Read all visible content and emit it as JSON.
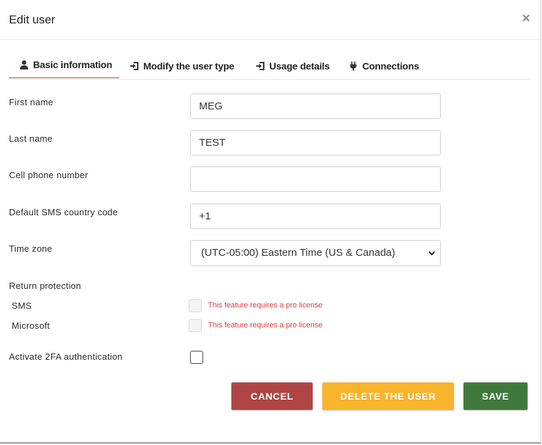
{
  "dialog": {
    "title": "Edit user",
    "close_glyph": "×"
  },
  "tabs": [
    {
      "label": "Basic information",
      "icon": "user-icon",
      "active": true
    },
    {
      "label": "Modify the user type",
      "icon": "sign-in-icon",
      "active": false
    },
    {
      "label": "Usage details",
      "icon": "sign-in-icon",
      "active": false
    },
    {
      "label": "Connections",
      "icon": "plug-icon",
      "active": false
    }
  ],
  "form": {
    "first_name": {
      "label": "First name",
      "value": "MEG"
    },
    "last_name": {
      "label": "Last name",
      "value": "TEST"
    },
    "cell_phone": {
      "label": "Cell phone number",
      "value": ""
    },
    "sms_country_code": {
      "label": "Default SMS country code",
      "value": "+1"
    },
    "time_zone": {
      "label": "Time zone",
      "value": "(UTC-05:00) Eastern Time (US & Canada)"
    },
    "return_protection": {
      "label": "Return protection",
      "sms": {
        "label": "SMS",
        "note": "This feature requires a pro license"
      },
      "microsoft": {
        "label": "Microsoft",
        "note": "This feature requires a pro license"
      }
    },
    "twofa": {
      "label": "Activate 2FA authentication",
      "checked": false
    }
  },
  "buttons": {
    "cancel": "CANCEL",
    "delete": "DELETE THE USER",
    "save": "SAVE"
  },
  "colors": {
    "cancel": "#b04545",
    "delete": "#f8b42a",
    "save": "#3f7a3c",
    "active_tab_underline": "#c9a27a",
    "pro_note": "#e03a3a"
  }
}
